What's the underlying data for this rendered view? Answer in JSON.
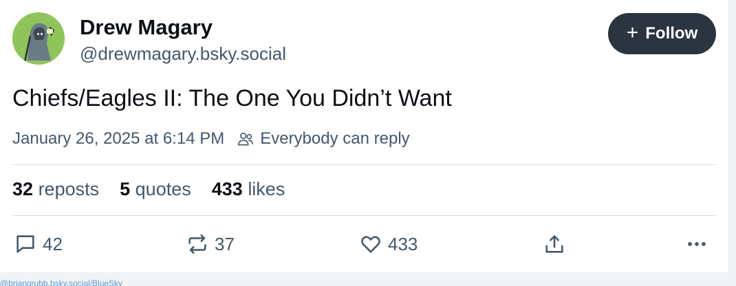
{
  "author": {
    "name": "Drew Magary",
    "handle": "@drewmagary.bsky.social",
    "avatar_icon": "grim-reaper-avatar"
  },
  "follow_button": {
    "label": "Follow",
    "icon": "plus-icon"
  },
  "post": {
    "text": "Chiefs/Eagles II: The One You Didn’t Want",
    "timestamp": "January 26, 2025 at 6:14 PM",
    "reply_setting": "Everybody can reply"
  },
  "stats": [
    {
      "count": "32",
      "label": "reposts"
    },
    {
      "count": "5",
      "label": "quotes"
    },
    {
      "count": "433",
      "label": "likes"
    }
  ],
  "actions": {
    "reply": {
      "icon": "comment-icon",
      "count": "42"
    },
    "repost": {
      "icon": "repost-icon",
      "count": "37"
    },
    "like": {
      "icon": "heart-icon",
      "count": "433"
    },
    "share": {
      "icon": "share-icon"
    },
    "more": {
      "icon": "more-dots-icon"
    }
  },
  "credit": "@briangrubb.bsky.social/BlueSky",
  "colors": {
    "follow_bg": "#2b3540",
    "secondary_text": "#42576c",
    "avatar_bg": "#8fc45a"
  }
}
